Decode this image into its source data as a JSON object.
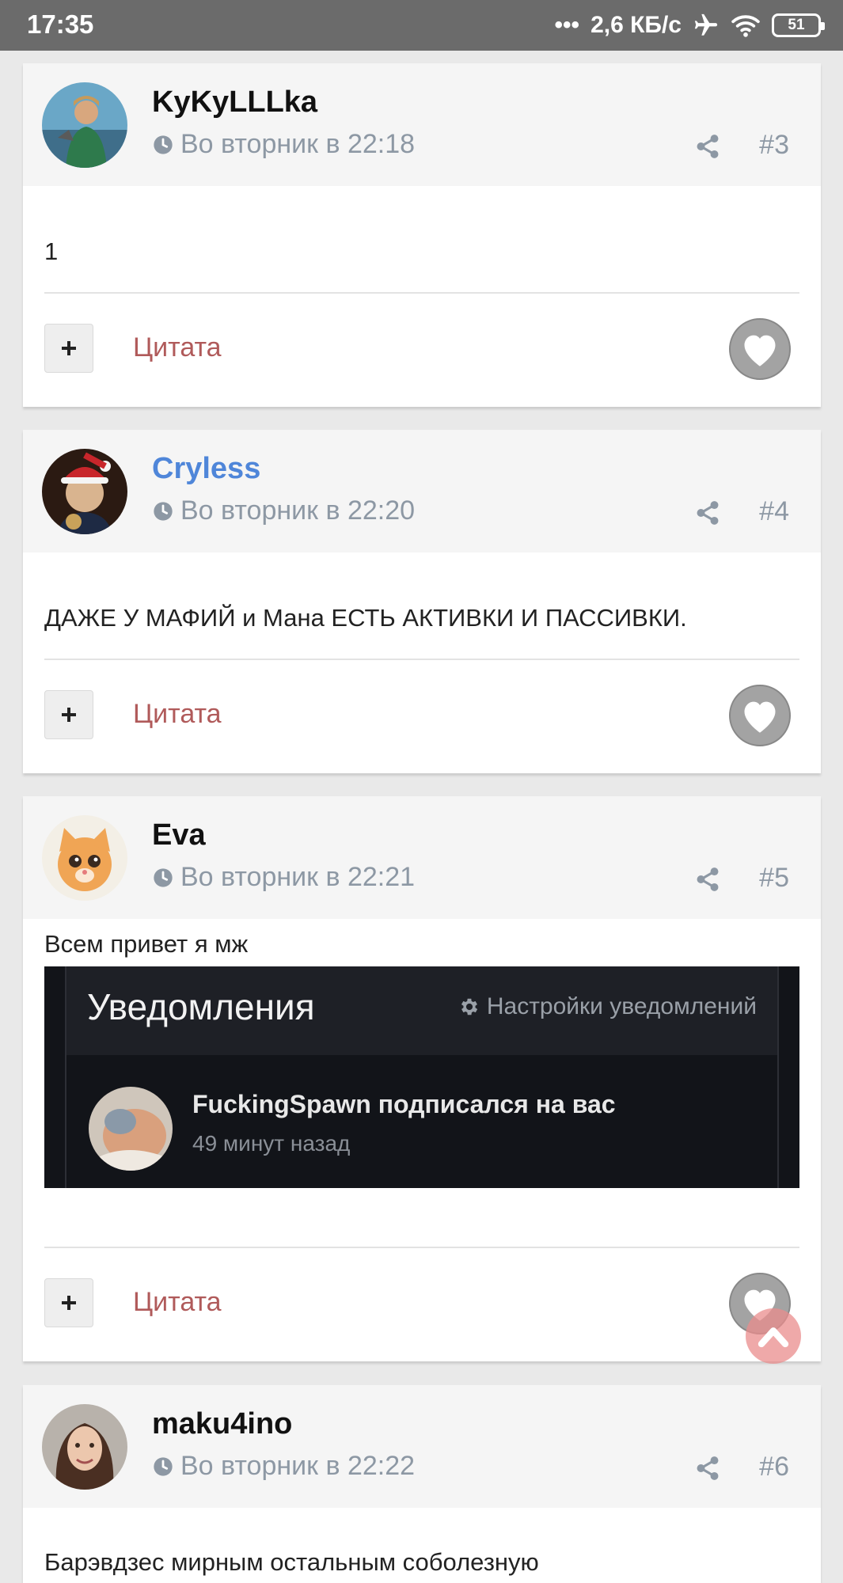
{
  "status_bar": {
    "time": "17:35",
    "network_speed": "2,6 КБ/с",
    "battery": "51",
    "icons": [
      "dots-icon",
      "airplane-icon",
      "wifi-icon",
      "battery-icon"
    ]
  },
  "posts": [
    {
      "username": "KyKyLLLka",
      "timestamp": "Во вторник в 22:18",
      "number": "#3",
      "body": "1",
      "quote_label": "Цитата",
      "username_color": "#111111"
    },
    {
      "username": "Cryless",
      "timestamp": "Во вторник в 22:20",
      "number": "#4",
      "body": "ДАЖЕ У МАФИЙ и Мана ЕСТЬ АКТИВКИ И ПАССИВКИ.",
      "quote_label": "Цитата",
      "username_color": "#4f86d9"
    },
    {
      "username": "Eva",
      "timestamp": "Во вторник в 22:21",
      "number": "#5",
      "body": "Всем привет я мж",
      "quote_label": "Цитата",
      "embedded_screenshot": {
        "title": "Уведомления",
        "settings_label": "Настройки уведомлений",
        "notification_text": "FuckingSpawn подписался на вас",
        "notification_time": "49 минут назад"
      }
    },
    {
      "username": "maku4ino",
      "timestamp": "Во вторник в 22:22",
      "number": "#6",
      "body": "Барэвдзес мирным остальным соболезную"
    }
  ],
  "colors": {
    "accent_link": "#4f86d9",
    "quote": "#b05a5a",
    "meta": "#8d98a4"
  }
}
